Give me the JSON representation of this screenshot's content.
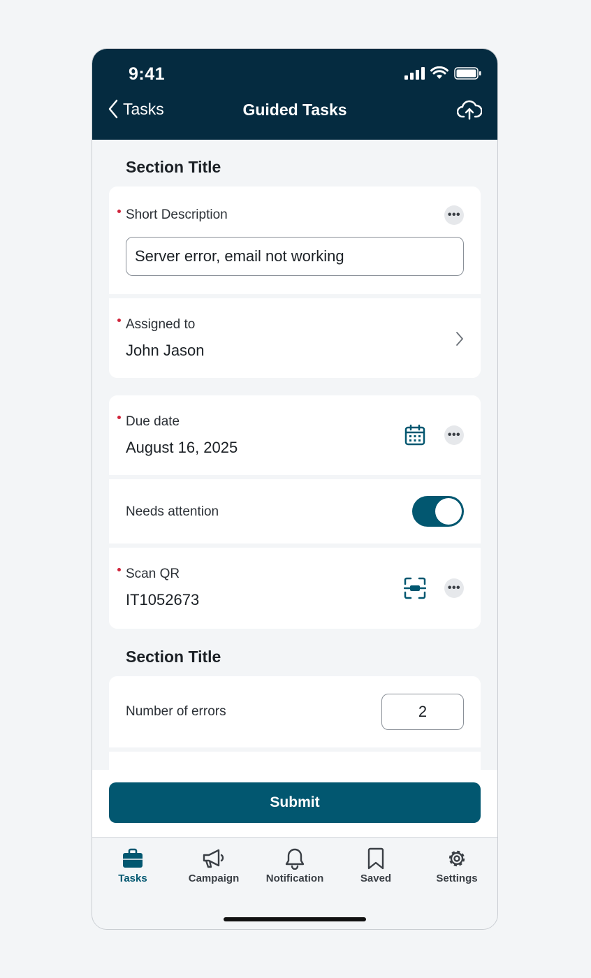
{
  "status_bar": {
    "time": "9:41"
  },
  "header": {
    "back_label": "Tasks",
    "title": "Guided Tasks"
  },
  "sections": [
    {
      "title": "Section Title"
    },
    {
      "title": "Section Title"
    }
  ],
  "fields": {
    "short_description": {
      "label": "Short Description",
      "value": "Server error, email not working",
      "required": true
    },
    "assigned_to": {
      "label": "Assigned to",
      "value": "John Jason",
      "required": true
    },
    "due_date": {
      "label": "Due date",
      "value": "August 16, 2025",
      "required": true
    },
    "needs_attention": {
      "label": "Needs attention",
      "on": true
    },
    "scan_qr": {
      "label": "Scan QR",
      "value": "IT1052673",
      "required": true
    },
    "number_of_errors": {
      "label": "Number of errors",
      "value": "2"
    }
  },
  "footer": {
    "submit_label": "Submit"
  },
  "tabbar": {
    "items": [
      {
        "label": "Tasks",
        "icon": "briefcase-icon",
        "active": true
      },
      {
        "label": "Campaign",
        "icon": "megaphone-icon"
      },
      {
        "label": "Notification",
        "icon": "bell-icon"
      },
      {
        "label": "Saved",
        "icon": "bookmark-icon"
      },
      {
        "label": "Settings",
        "icon": "gear-icon"
      }
    ]
  },
  "colors": {
    "header_bg": "#052b40",
    "accent": "#025770",
    "required": "#d0243b",
    "background": "#f3f5f7"
  }
}
